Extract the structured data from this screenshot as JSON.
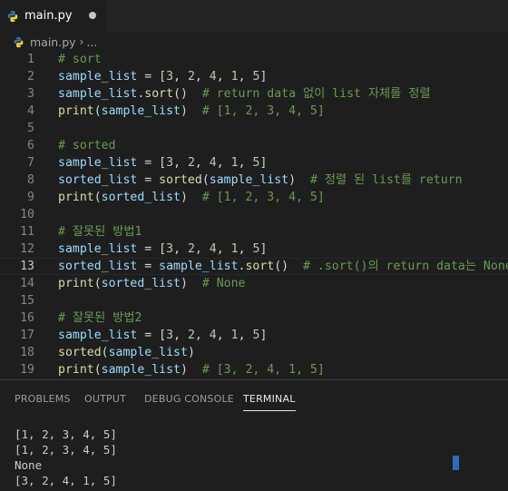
{
  "tab": {
    "filename": "main.py",
    "dirty_indicator": "dot-icon"
  },
  "breadcrumb": {
    "file": "main.py",
    "separator": "›",
    "ellipsis": "..."
  },
  "colors": {
    "background": "#1e1e1e",
    "variable": "#9cdcfe",
    "function": "#dcdcaa",
    "number": "#b5cea8",
    "comment": "#6a9955",
    "cursor": "#2d6db5"
  },
  "editor": {
    "current_line": 13,
    "lines": [
      {
        "n": "1",
        "tokens": [
          {
            "t": "# sort",
            "k": "c"
          }
        ]
      },
      {
        "n": "2",
        "tokens": [
          {
            "t": "sample_list",
            "k": "v"
          },
          {
            "t": " = [",
            "k": "p"
          },
          {
            "t": "3",
            "k": "n"
          },
          {
            "t": ", ",
            "k": "p"
          },
          {
            "t": "2",
            "k": "n"
          },
          {
            "t": ", ",
            "k": "p"
          },
          {
            "t": "4",
            "k": "n"
          },
          {
            "t": ", ",
            "k": "p"
          },
          {
            "t": "1",
            "k": "n"
          },
          {
            "t": ", ",
            "k": "p"
          },
          {
            "t": "5",
            "k": "n"
          },
          {
            "t": "]",
            "k": "p"
          }
        ]
      },
      {
        "n": "3",
        "tokens": [
          {
            "t": "sample_list",
            "k": "v"
          },
          {
            "t": ".",
            "k": "p"
          },
          {
            "t": "sort",
            "k": "f"
          },
          {
            "t": "()  ",
            "k": "p"
          },
          {
            "t": "# return data 없이 list 자체를 정렬",
            "k": "c"
          }
        ]
      },
      {
        "n": "4",
        "tokens": [
          {
            "t": "print",
            "k": "f"
          },
          {
            "t": "(",
            "k": "p"
          },
          {
            "t": "sample_list",
            "k": "v"
          },
          {
            "t": ")  ",
            "k": "p"
          },
          {
            "t": "# [1, 2, 3, 4, 5]",
            "k": "c"
          }
        ]
      },
      {
        "n": "5",
        "tokens": []
      },
      {
        "n": "6",
        "tokens": [
          {
            "t": "# sorted",
            "k": "c"
          }
        ]
      },
      {
        "n": "7",
        "tokens": [
          {
            "t": "sample_list",
            "k": "v"
          },
          {
            "t": " = [",
            "k": "p"
          },
          {
            "t": "3",
            "k": "n"
          },
          {
            "t": ", ",
            "k": "p"
          },
          {
            "t": "2",
            "k": "n"
          },
          {
            "t": ", ",
            "k": "p"
          },
          {
            "t": "4",
            "k": "n"
          },
          {
            "t": ", ",
            "k": "p"
          },
          {
            "t": "1",
            "k": "n"
          },
          {
            "t": ", ",
            "k": "p"
          },
          {
            "t": "5",
            "k": "n"
          },
          {
            "t": "]",
            "k": "p"
          }
        ]
      },
      {
        "n": "8",
        "tokens": [
          {
            "t": "sorted_list",
            "k": "v"
          },
          {
            "t": " = ",
            "k": "p"
          },
          {
            "t": "sorted",
            "k": "f"
          },
          {
            "t": "(",
            "k": "p"
          },
          {
            "t": "sample_list",
            "k": "v"
          },
          {
            "t": ")  ",
            "k": "p"
          },
          {
            "t": "# 정렬 된 list를 return",
            "k": "c"
          }
        ]
      },
      {
        "n": "9",
        "tokens": [
          {
            "t": "print",
            "k": "f"
          },
          {
            "t": "(",
            "k": "p"
          },
          {
            "t": "sorted_list",
            "k": "v"
          },
          {
            "t": ")  ",
            "k": "p"
          },
          {
            "t": "# [1, 2, 3, 4, 5]",
            "k": "c"
          }
        ]
      },
      {
        "n": "10",
        "tokens": []
      },
      {
        "n": "11",
        "tokens": [
          {
            "t": "# 잘못된 방법1",
            "k": "c"
          }
        ]
      },
      {
        "n": "12",
        "tokens": [
          {
            "t": "sample_list",
            "k": "v"
          },
          {
            "t": " = [",
            "k": "p"
          },
          {
            "t": "3",
            "k": "n"
          },
          {
            "t": ", ",
            "k": "p"
          },
          {
            "t": "2",
            "k": "n"
          },
          {
            "t": ", ",
            "k": "p"
          },
          {
            "t": "4",
            "k": "n"
          },
          {
            "t": ", ",
            "k": "p"
          },
          {
            "t": "1",
            "k": "n"
          },
          {
            "t": ", ",
            "k": "p"
          },
          {
            "t": "5",
            "k": "n"
          },
          {
            "t": "]",
            "k": "p"
          }
        ]
      },
      {
        "n": "13",
        "tokens": [
          {
            "t": "sorted_list",
            "k": "v"
          },
          {
            "t": " = ",
            "k": "p"
          },
          {
            "t": "sample_list",
            "k": "v"
          },
          {
            "t": ".",
            "k": "p"
          },
          {
            "t": "sort",
            "k": "f"
          },
          {
            "t": "()  ",
            "k": "p"
          },
          {
            "t": "# .sort()의 return data는 None",
            "k": "c"
          }
        ]
      },
      {
        "n": "14",
        "tokens": [
          {
            "t": "print",
            "k": "f"
          },
          {
            "t": "(",
            "k": "p"
          },
          {
            "t": "sorted_list",
            "k": "v"
          },
          {
            "t": ")  ",
            "k": "p"
          },
          {
            "t": "# None",
            "k": "c"
          }
        ]
      },
      {
        "n": "15",
        "tokens": []
      },
      {
        "n": "16",
        "tokens": [
          {
            "t": "# 잘못된 방법2",
            "k": "c"
          }
        ]
      },
      {
        "n": "17",
        "tokens": [
          {
            "t": "sample_list",
            "k": "v"
          },
          {
            "t": " = [",
            "k": "p"
          },
          {
            "t": "3",
            "k": "n"
          },
          {
            "t": ", ",
            "k": "p"
          },
          {
            "t": "2",
            "k": "n"
          },
          {
            "t": ", ",
            "k": "p"
          },
          {
            "t": "4",
            "k": "n"
          },
          {
            "t": ", ",
            "k": "p"
          },
          {
            "t": "1",
            "k": "n"
          },
          {
            "t": ", ",
            "k": "p"
          },
          {
            "t": "5",
            "k": "n"
          },
          {
            "t": "]",
            "k": "p"
          }
        ]
      },
      {
        "n": "18",
        "tokens": [
          {
            "t": "sorted",
            "k": "f"
          },
          {
            "t": "(",
            "k": "p"
          },
          {
            "t": "sample_list",
            "k": "v"
          },
          {
            "t": ")",
            "k": "p"
          }
        ]
      },
      {
        "n": "19",
        "tokens": [
          {
            "t": "print",
            "k": "f"
          },
          {
            "t": "(",
            "k": "p"
          },
          {
            "t": "sample_list",
            "k": "v"
          },
          {
            "t": ")  ",
            "k": "p"
          },
          {
            "t": "# [3, 2, 4, 1, 5]",
            "k": "c"
          }
        ]
      }
    ]
  },
  "panel": {
    "tabs": [
      {
        "label": "PROBLEMS",
        "active": false
      },
      {
        "label": "OUTPUT",
        "active": false
      },
      {
        "label": "DEBUG CONSOLE",
        "active": false
      },
      {
        "label": "TERMINAL",
        "active": true
      }
    ],
    "terminal_lines": [
      "[1, 2, 3, 4, 5]",
      "[1, 2, 3, 4, 5]",
      "None",
      "[3, 2, 4, 1, 5]"
    ]
  }
}
